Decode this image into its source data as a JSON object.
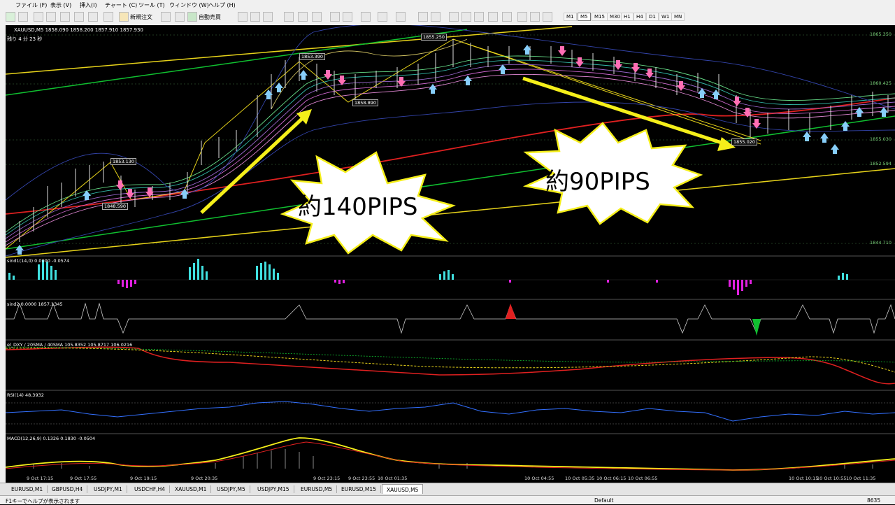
{
  "menu": [
    "ファイル (F)",
    "表示 (V)",
    "挿入(I)",
    "チャート (C)",
    "ツール (T)",
    "ウィンドウ (W)",
    "ヘルプ (H)"
  ],
  "toolbar": {
    "new_order_label": "新規注文",
    "auto_trade_label": "自動売買",
    "timeframes": [
      "M1",
      "M5",
      "M15",
      "M30",
      "H1",
      "H4",
      "D1",
      "W1",
      "MN"
    ],
    "active_timeframe": "M5"
  },
  "chart": {
    "symbol_header": "XAUUSD,M5  1858.090 1858.200 1857.910 1857.930",
    "remaining": "残り 4 分 23 秒",
    "price_tags": {
      "p1": "1853.390",
      "p2": "1855.250",
      "p3": "1858.890",
      "p4": "1853.130",
      "p5": "1848.590",
      "p6": "1855.020"
    },
    "axis_prices": {
      "a1": "1865.350",
      "a2": "1860.425",
      "a3": "1855.030",
      "a4": "1852.594",
      "a5": "1844.710"
    },
    "annotations": {
      "up": "約140PIPS",
      "down": "約90PIPS"
    },
    "colors": {
      "up_arrow": "#f5ef1a",
      "burst_fill": "#ffffff",
      "burst_stroke": "#f5ef1a",
      "ma_red": "#e02020",
      "trend_green": "#10c030",
      "trend_yellow": "#e6d21a",
      "buy_arrow": "#87cefa",
      "sell_arrow": "#ff6eb4"
    }
  },
  "panels": {
    "sind1": "sind1(14,0) 0.0000 -0.0574",
    "sind2": "sind2 0.0000 1857.1345",
    "dxy": "el_DXY / 20SMA / 40SMA 105.8352 105.8717 106.0216",
    "rsi": "RSI(14) 48.3932",
    "macd": "MACD(12,26,9) 0.1326 0.1830 -0.0504"
  },
  "time_labels": [
    "9 Oct 17:15",
    "9 Oct 17:55",
    "9 Oct 19:15",
    "9 Oct 20:35",
    "9 Oct 23:15",
    "9 Oct 23:55",
    "10 Oct 01:35",
    "10 Oct 04:55",
    "10 Oct 05:35",
    "10 Oct 06:15",
    "10 Oct 06:55",
    "10 Oct 10:15",
    "10 Oct 10:55",
    "10 Oct 11:35"
  ],
  "tabs": [
    "EURUSD,M1",
    "GBPUSD,H4",
    "USDJPY,M1",
    "USDCHF,H4",
    "XAUUSD,M1",
    "USDJPY,M5",
    "USDJPY,M15",
    "EURUSD,M5",
    "EURUSD,M15",
    "XAUUSD,M5"
  ],
  "active_tab": "XAUUSD,M5",
  "status": {
    "help": "F1キーでヘルプが表示されます",
    "profile": "Default",
    "traffic": "8635"
  }
}
